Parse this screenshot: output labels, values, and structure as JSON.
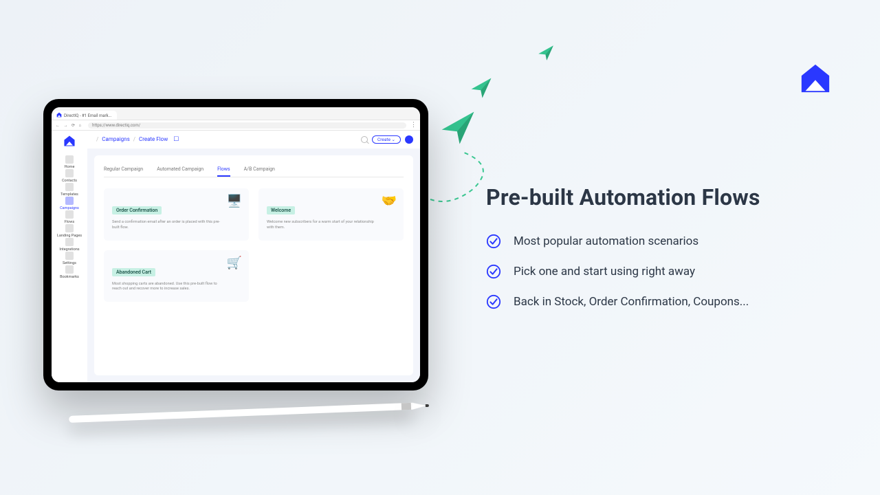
{
  "promo": {
    "title": "Pre-built Automation Flows",
    "checks": [
      "Most popular automation scenarios",
      "Pick one and start using right away",
      "Back in Stock, Order Confirmation, Coupons..."
    ]
  },
  "browser": {
    "tab_title": "DirectIQ - #1 Email mark...",
    "url": "https://www.directiq.com/"
  },
  "app": {
    "breadcrumbs": [
      "Campaigns",
      "Create Flow"
    ],
    "header": {
      "create_label": "Create ⌄"
    },
    "sidebar": [
      {
        "label": "Home"
      },
      {
        "label": "Contacts"
      },
      {
        "label": "Templates"
      },
      {
        "label": "Campaigns",
        "active": true
      },
      {
        "label": "Flows"
      },
      {
        "label": "Landing Pages"
      },
      {
        "label": "Integrations"
      },
      {
        "label": "Settings"
      },
      {
        "label": "Bookmarks"
      }
    ],
    "tabs": [
      {
        "label": "Regular Campaign"
      },
      {
        "label": "Automated Campaign"
      },
      {
        "label": "Flows",
        "active": true
      },
      {
        "label": "A/B Campaign"
      }
    ],
    "cards": [
      {
        "title": "Order Confirmation",
        "desc": "Send a confirmation email after an order is placed with this pre-built flow.",
        "icon": "🖥️"
      },
      {
        "title": "Welcome",
        "desc": "Welcome new subscribers for a warm start of your relationship with them.",
        "icon": "🤝"
      },
      {
        "title": "Abandoned Cart",
        "desc": "Most shopping carts are abandoned. Use this pre-built flow to reach out and recover more to increase sales.",
        "icon": "🛒"
      }
    ]
  }
}
